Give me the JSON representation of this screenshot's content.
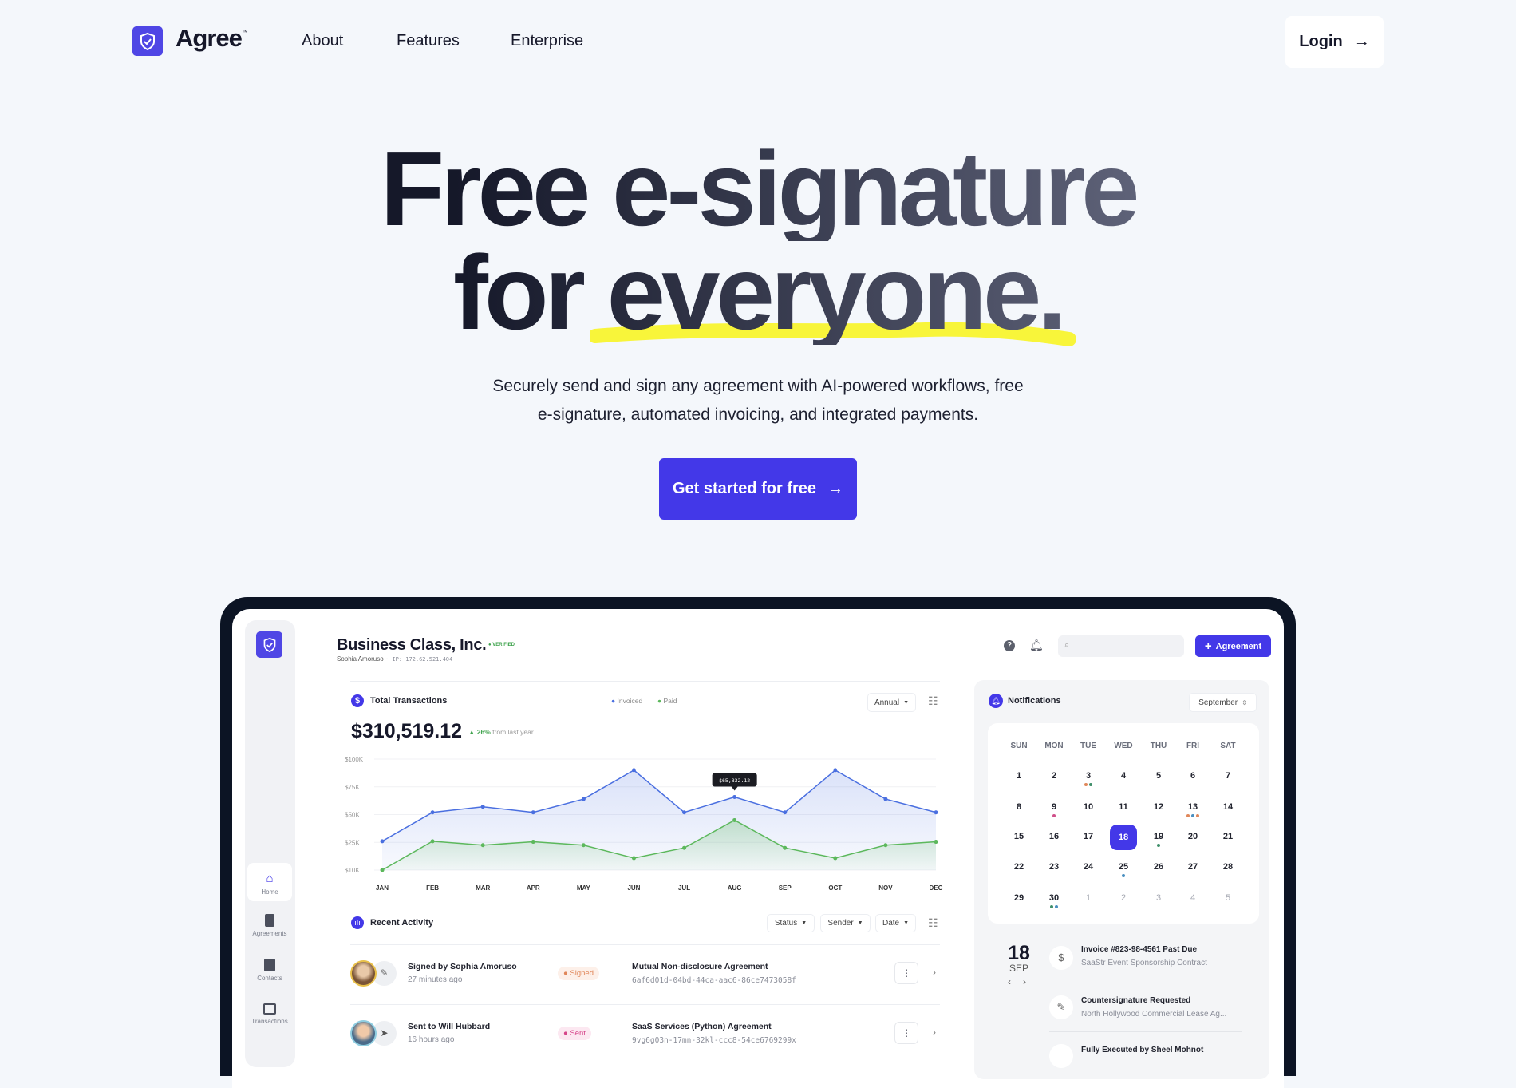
{
  "nav": {
    "brand": "Agree",
    "tm": "™",
    "links": [
      "About",
      "Features",
      "Enterprise"
    ],
    "login": "Login"
  },
  "hero": {
    "line1": "Free e-signature",
    "line2": "for everyone.",
    "subtitle": [
      "Securely send and sign any agreement with AI-powered workflows, free",
      "e-signature, automated invoicing, and integrated payments."
    ],
    "cta": "Get started for free",
    "highlight_color": "#f8f53a",
    "accent": "#4338e8"
  },
  "dashboard": {
    "company": "Business Class, Inc.",
    "verified": "VERIFIED",
    "user": "Sophia Amoruso",
    "ip": "· IP: 172.62.521.404",
    "new_button": "Agreement",
    "sidebar": [
      "Home",
      "Agreements",
      "Contacts",
      "Transactions"
    ],
    "transactions": {
      "title": "Total Transactions",
      "legend": [
        "Invoiced",
        "Paid"
      ],
      "period": "Annual",
      "total": "$310,519.12",
      "change": "26%",
      "change_note": "from last year",
      "tooltip": "$65,832.12"
    },
    "chart_data": {
      "type": "area",
      "x": [
        "JAN",
        "FEB",
        "MAR",
        "APR",
        "MAY",
        "JUN",
        "JUL",
        "AUG",
        "SEP",
        "OCT",
        "NOV",
        "DEC"
      ],
      "yticks": [
        "$100K",
        "$75K",
        "$50K",
        "$25K",
        "$10K"
      ],
      "ytick_values": [
        100,
        75,
        50,
        25,
        10
      ],
      "unit": "$K",
      "series": [
        {
          "name": "Invoiced",
          "color": "#4a6fe0",
          "values": [
            26,
            52,
            57,
            52,
            64,
            90,
            52,
            65.8,
            52,
            90,
            64,
            52
          ]
        },
        {
          "name": "Paid",
          "color": "#5cb85c",
          "values": [
            10,
            26,
            23.5,
            25.5,
            23.5,
            16.5,
            22,
            45,
            22,
            16.5,
            23.5,
            25.5
          ]
        }
      ],
      "grid": true,
      "legend": "top"
    },
    "activity": {
      "title": "Recent Activity",
      "filters": [
        "Status",
        "Sender",
        "Date"
      ],
      "rows": [
        {
          "title": "Signed by Sophia Amoruso",
          "time": "27 minutes ago",
          "status": "Signed",
          "status_color": "#e0875a",
          "doc": "Mutual Non-disclosure Agreement",
          "id": "6af6d01d-04bd-44ca-aac6-86ce7473058f"
        },
        {
          "title": "Sent to Will Hubbard",
          "time": "16 hours ago",
          "status": "Sent",
          "status_color": "#d6458a",
          "doc": "SaaS Services (Python) Agreement",
          "id": "9vg6g03n-17mn-32kl-ccc8-54ce6769299x"
        }
      ]
    },
    "notifications": {
      "title": "Notifications",
      "month": "September",
      "weekdays": [
        "SUN",
        "MON",
        "TUE",
        "WED",
        "THU",
        "FRI",
        "SAT"
      ],
      "days": [
        [
          "1",
          "2",
          "3",
          "4",
          "5",
          "6",
          "7"
        ],
        [
          "8",
          "9",
          "10",
          "11",
          "12",
          "13",
          "14"
        ],
        [
          "15",
          "16",
          "17",
          "18",
          "19",
          "20",
          "21"
        ],
        [
          "22",
          "23",
          "24",
          "25",
          "26",
          "27",
          "28"
        ],
        [
          "29",
          "30",
          "1",
          "2",
          "3",
          "4",
          "5"
        ]
      ],
      "selected": "18",
      "dots": {
        "3": [
          "#e0875a",
          "#3f8f6a"
        ],
        "9": [
          "#d0508a"
        ],
        "13": [
          "#e0875a",
          "#4a8fc0",
          "#e0875a"
        ],
        "19": [
          "#3f8f6a"
        ],
        "25": [
          "#4a8fc0"
        ],
        "30": [
          "#3f8f6a",
          "#4a8fc0"
        ]
      },
      "date_day": "18",
      "date_month": "SEP",
      "items": [
        {
          "title": "Invoice #823-98-4561 Past Due",
          "sub": "SaaStr Event Sponsorship Contract"
        },
        {
          "title": "Countersignature Requested",
          "sub": "North Hollywood Commercial Lease Ag..."
        },
        {
          "title": "Fully Executed by Sheel Mohnot",
          "sub": ""
        }
      ]
    }
  }
}
